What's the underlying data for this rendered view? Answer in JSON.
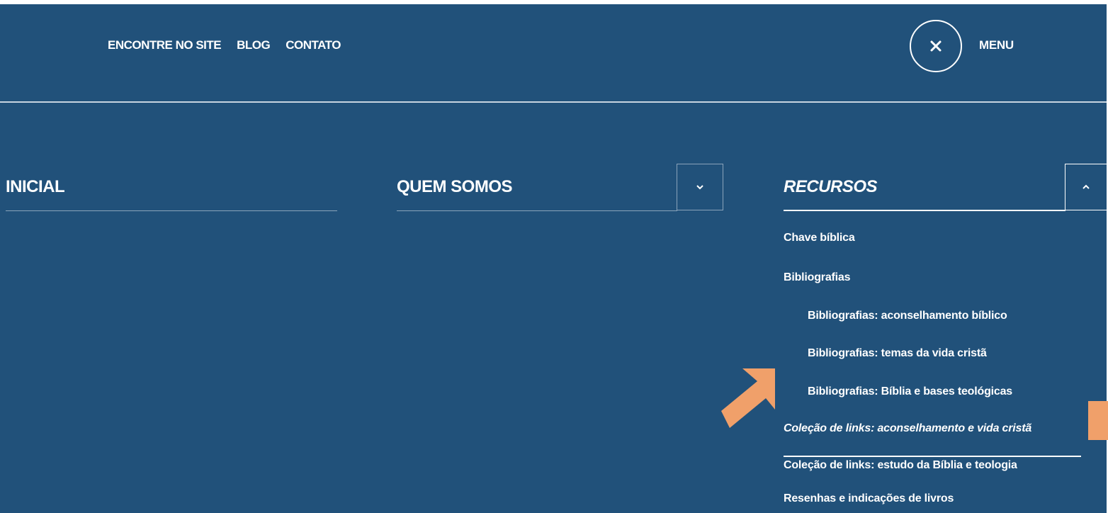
{
  "topnav": [
    "ENCONTRE NO SITE",
    "BLOG",
    "CONTATO"
  ],
  "menu_label": "MENU",
  "columns": {
    "inicial": "INICIAL",
    "quem_somos": "QUEM SOMOS",
    "recursos": "RECURSOS"
  },
  "recursos_items": [
    "Chave bíblica",
    "Bibliografias",
    "Bibliografias: aconselhamento bíblico",
    "Bibliografias: temas da vida cristã",
    "Bibliografias: Bíblia e bases teológicas",
    "Coleção de links: aconselhamento e vida cristã",
    "Coleção de links: estudo da Bíblia e teologia",
    "Resenhas e indicações de livros"
  ],
  "colors": {
    "background": "#21517a",
    "text": "#ffffff",
    "highlight_arrow": "#f0a06a"
  },
  "icons": {
    "close": "close-icon",
    "quem_somos_toggle": "chevron-down-icon",
    "recursos_toggle": "chevron-up-icon",
    "annotation": "arrow-icon"
  }
}
